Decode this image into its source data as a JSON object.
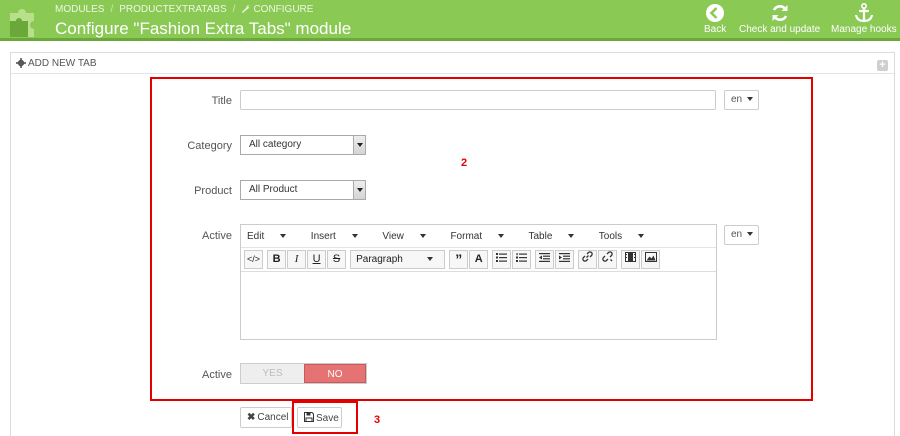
{
  "header": {
    "breadcrumb": [
      "MODULES",
      "PRODUCTEXTRATABS",
      "CONFIGURE"
    ],
    "title": "Configure \"Fashion Extra Tabs\" module",
    "toolbar": [
      {
        "label": "Back",
        "icon": "back-arrow-icon"
      },
      {
        "label": "Check and update",
        "icon": "refresh-icon"
      },
      {
        "label": "Manage hooks",
        "icon": "anchor-icon"
      }
    ]
  },
  "panel": {
    "heading": "ADD NEW TAB"
  },
  "form": {
    "title_label": "Title",
    "title_value": "",
    "lang": "en",
    "category_label": "Category",
    "category_value": "All category",
    "product_label": "Product",
    "product_value": "All Product",
    "active_editor_label": "Active",
    "editor_menu": [
      "Edit",
      "Insert",
      "View",
      "Format",
      "Table",
      "Tools"
    ],
    "paragraph": "Paragraph",
    "active_switch_label": "Active",
    "switch_yes": "YES",
    "switch_no": "NO",
    "switch_value": "NO",
    "cancel": "Cancel",
    "save": "Save"
  },
  "annotations": [
    "2",
    "3"
  ],
  "colors": {
    "header_green": "#8bc955",
    "switch_no": "#e57373",
    "annotation_red": "#e50000"
  }
}
